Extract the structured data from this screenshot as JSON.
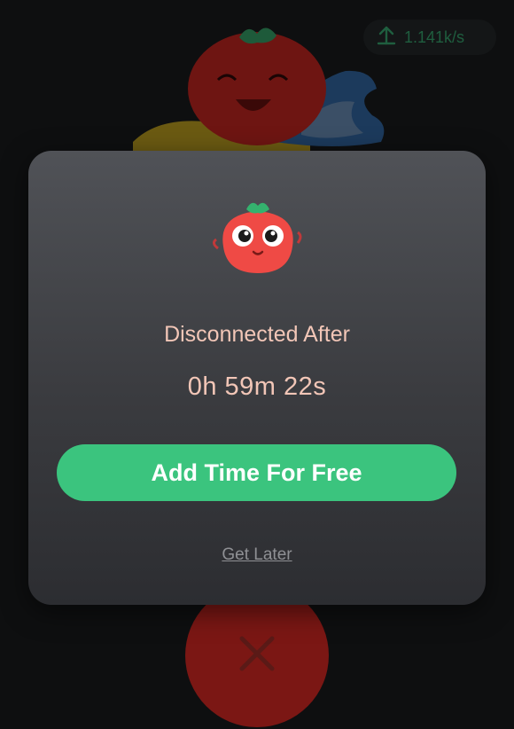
{
  "status": {
    "upload_speed": "1.141k/s",
    "upload_icon": "arrow-up-icon"
  },
  "background": {
    "mascot_icon": "laughing-tomato-icon",
    "close_icon": "close-icon",
    "close_button_color": "#7b1714"
  },
  "dialog": {
    "mascot_icon": "tomato-mascot-icon",
    "title": "Disconnected After",
    "timer": "0h 59m 22s",
    "primary_button_label": "Add Time For Free",
    "secondary_link_label": "Get Later",
    "accent_color": "#3bc47e",
    "text_color": "#f2c6b7"
  }
}
